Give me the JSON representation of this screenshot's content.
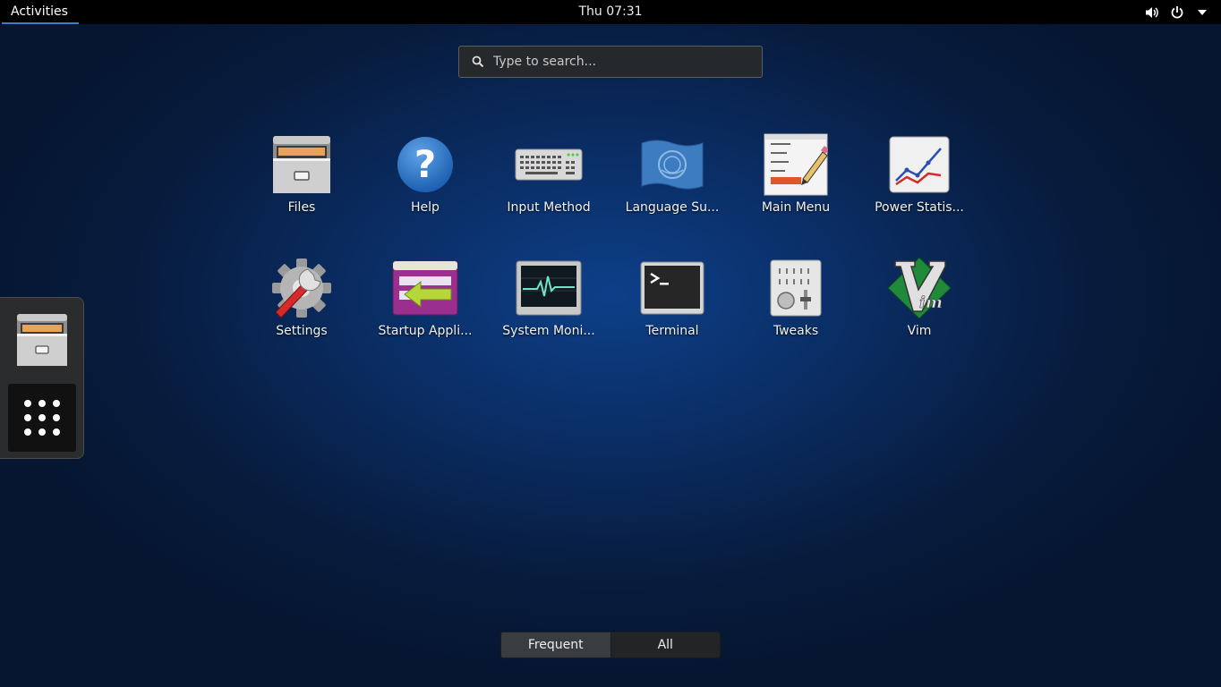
{
  "topbar": {
    "activities_label": "Activities",
    "clock": "Thu 07:31",
    "icons": [
      "volume-icon",
      "power-icon",
      "chevron-down-icon"
    ]
  },
  "search": {
    "placeholder": "Type to search..."
  },
  "apps": [
    {
      "label": "Files",
      "icon": "files-icon"
    },
    {
      "label": "Help",
      "icon": "help-icon"
    },
    {
      "label": "Input Method",
      "icon": "keyboard-icon"
    },
    {
      "label": "Language Su...",
      "icon": "language-flag-icon"
    },
    {
      "label": "Main Menu",
      "icon": "main-menu-icon"
    },
    {
      "label": "Power Statis...",
      "icon": "power-statistics-icon"
    },
    {
      "label": "Settings",
      "icon": "settings-icon"
    },
    {
      "label": "Startup Appli...",
      "icon": "startup-applications-icon"
    },
    {
      "label": "System Moni...",
      "icon": "system-monitor-icon"
    },
    {
      "label": "Terminal",
      "icon": "terminal-icon"
    },
    {
      "label": "Tweaks",
      "icon": "tweaks-icon"
    },
    {
      "label": "Vim",
      "icon": "vim-icon"
    }
  ],
  "dash": {
    "favorites": [
      "files-icon"
    ],
    "show_apps_icon": "grid-dots-icon"
  },
  "view_switch": {
    "frequent_label": "Frequent",
    "all_label": "All",
    "selected": "Frequent"
  }
}
